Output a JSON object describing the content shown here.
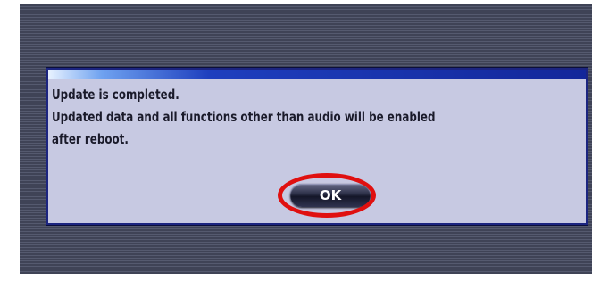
{
  "dialog": {
    "lines": [
      "Update is completed.",
      "Updated data and all functions other than audio will be enabled",
      "after reboot."
    ],
    "ok_label": "OK"
  },
  "annotation": {
    "highlight_color": "#e01010",
    "highlight_target": "ok-button"
  },
  "colors": {
    "background_stripes": "#4a4e62",
    "dialog_background": "#c7c9e2",
    "dialog_border": "#1c2580"
  }
}
